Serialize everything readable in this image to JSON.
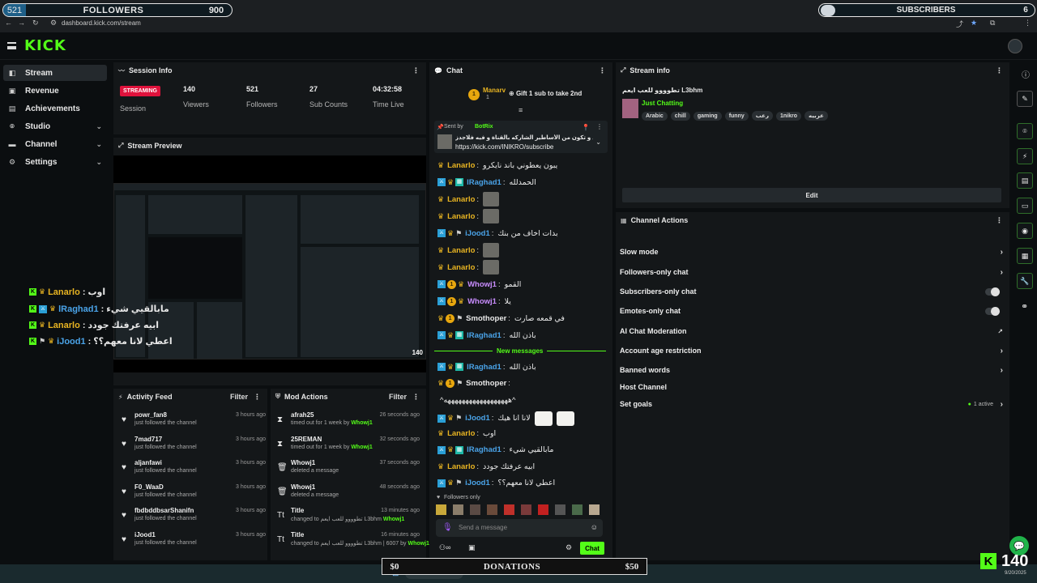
{
  "browser": {
    "url": "dashboard.kick.com/stream"
  },
  "followers_overlay": {
    "current": "521",
    "title": "FOLLOWERS",
    "goal": "900"
  },
  "subs_overlay": {
    "title": "SUBSCRIBERS",
    "goal": "6"
  },
  "brand": {
    "logo": "KICK",
    "accent": "#53fc18"
  },
  "nav": {
    "items": [
      {
        "label": "Stream",
        "icon": "stream-icon",
        "active": true
      },
      {
        "label": "Revenue",
        "icon": "revenue-icon"
      },
      {
        "label": "Achievements",
        "icon": "achievements-icon"
      },
      {
        "label": "Studio",
        "icon": "studio-icon",
        "expandable": true
      },
      {
        "label": "Channel",
        "icon": "channel-icon",
        "expandable": true
      },
      {
        "label": "Settings",
        "icon": "settings-icon",
        "expandable": true
      }
    ]
  },
  "session": {
    "title": "Session Info",
    "badge": "STREAMING",
    "badge_label": "Session",
    "stats": [
      {
        "value": "140",
        "label": "Viewers"
      },
      {
        "value": "521",
        "label": "Followers"
      },
      {
        "value": "27",
        "label": "Sub Counts"
      },
      {
        "value": "04:32:58",
        "label": "Time Live"
      }
    ]
  },
  "preview": {
    "title": "Stream Preview",
    "viewer_count": "140"
  },
  "overlay_chat": [
    {
      "user": "Lanarlo",
      "msg": "اوب"
    },
    {
      "user": "lRaghad1",
      "msg": "مابالقيي شيء"
    },
    {
      "user": "Lanarlo",
      "msg": "ابيه عرفتك جودد"
    },
    {
      "user": "iJood1",
      "msg": "اعطي لانا معهم؟؟"
    }
  ],
  "activity": {
    "title": "Activity Feed",
    "filter": "Filter",
    "items": [
      {
        "user": "powr_fan8",
        "action": "just followed the channel",
        "time": "3 hours ago"
      },
      {
        "user": "7mad717",
        "action": "just followed the channel",
        "time": "3 hours ago"
      },
      {
        "user": "aljanfawi",
        "action": "just followed the channel",
        "time": "3 hours ago"
      },
      {
        "user": "F0_WaaD",
        "action": "just followed the channel",
        "time": "3 hours ago"
      },
      {
        "user": "fbdbddbsarShanifn",
        "action": "just followed the channel",
        "time": "3 hours ago"
      },
      {
        "user": "iJood1",
        "action": "just followed the channel",
        "time": "3 hours ago"
      }
    ]
  },
  "mod": {
    "title": "Mod Actions",
    "filter": "Filter",
    "items": [
      {
        "user": "afrah25",
        "detail": "timed out for 1 week by",
        "by": "Whowj1",
        "time": "26 seconds ago",
        "icon": "hourglass-icon"
      },
      {
        "user": "25REMAN",
        "detail": "timed out for 1 week by",
        "by": "Whowj1",
        "time": "32 seconds ago",
        "icon": "hourglass-icon"
      },
      {
        "user": "Whowj1",
        "detail": "deleted a message",
        "by": "",
        "time": "37 seconds ago",
        "icon": "trash-icon"
      },
      {
        "user": "Whowj1",
        "detail": "deleted a message",
        "by": "",
        "time": "48 seconds ago",
        "icon": "trash-icon"
      },
      {
        "user": "Title",
        "detail": "changed to تطوووو للعب ايعم L3bhm",
        "by": "Whowj1",
        "time": "13 minutes ago",
        "icon": "title-icon"
      },
      {
        "user": "Title",
        "detail": "changed to تطوووو للعب ايعم L3bhm | 6007 by",
        "by": "Whowj1",
        "time": "16 minutes ago",
        "icon": "title-icon"
      }
    ]
  },
  "chat": {
    "title": "Chat",
    "gift_user": "Manarv",
    "gift_count": "1",
    "gift_text": "Gift 1 sub to take 2nd",
    "pinned_by_label": "Sent by",
    "pinned_by": "BotRix",
    "pinned_text": "انا كبي كمصلي و تكون من الأساطير الشاركه بالقناة و فيه فلاجدز",
    "pinned_link": "https://kick.com/INIKRO/subscribe",
    "new_messages": "New messages",
    "followers_only": "Followers only",
    "placeholder": "Send a message",
    "send": "Chat",
    "messages_before": [
      {
        "user": "Lanarlo",
        "cls": "u-lanarlo",
        "msg": "يبون يعطوني باند نايكرو",
        "badges": [
          "crown"
        ]
      },
      {
        "user": "lRaghad1",
        "cls": "u-iraghad",
        "msg": "الحمدلله",
        "badges": [
          "mod",
          "crown",
          "sub-b"
        ]
      },
      {
        "user": "Lanarlo",
        "cls": "u-lanarlo",
        "msg": "",
        "badges": [
          "crown"
        ],
        "emote": true
      },
      {
        "user": "Lanarlo",
        "cls": "u-lanarlo",
        "msg": "",
        "badges": [
          "crown"
        ],
        "emote": true
      },
      {
        "user": "iJood1",
        "cls": "u-ijood",
        "msg": "بدات اخاف من بنك",
        "badges": [
          "mod",
          "crown",
          "gift"
        ]
      },
      {
        "user": "Lanarlo",
        "cls": "u-lanarlo",
        "msg": "",
        "badges": [
          "crown"
        ],
        "emote": true
      },
      {
        "user": "Lanarlo",
        "cls": "u-lanarlo",
        "msg": "",
        "badges": [
          "crown"
        ],
        "emote": true
      },
      {
        "user": "Whowj1",
        "cls": "u-whowj",
        "msg": "القمو",
        "badges": [
          "mod",
          "sub",
          "crown"
        ]
      },
      {
        "user": "Whowj1",
        "cls": "u-whowj",
        "msg": "يلا",
        "badges": [
          "mod",
          "sub",
          "crown"
        ]
      },
      {
        "user": "Smothoper",
        "cls": "u-smoth",
        "msg": "في قمعه صارت",
        "badges": [
          "crown",
          "sub",
          "gift"
        ]
      },
      {
        "user": "lRaghad1",
        "cls": "u-iraghad",
        "msg": "باذن الله",
        "badges": [
          "mod",
          "crown",
          "sub-b"
        ]
      }
    ],
    "messages_after": [
      {
        "user": "lRaghad1",
        "cls": "u-iraghad",
        "msg": "باذن الله",
        "badges": [
          "mod",
          "crown",
          "sub-b"
        ]
      },
      {
        "user": "Smothoper",
        "cls": "u-smoth",
        "msg": "",
        "badges": [
          "crown",
          "sub",
          "gift"
        ]
      },
      {
        "user": "",
        "cls": "u-smoth",
        "msg": "^ههههههههههههههههههه^",
        "badges": []
      },
      {
        "user": "iJood1",
        "cls": "u-ijood",
        "msg": "لانا انا هيك",
        "badges": [
          "mod",
          "crown",
          "gift"
        ],
        "faces": true
      },
      {
        "user": "Lanarlo",
        "cls": "u-lanarlo",
        "msg": "اوب",
        "badges": [
          "crown"
        ]
      },
      {
        "user": "lRaghad1",
        "cls": "u-iraghad",
        "msg": "مابالقيي شيء",
        "badges": [
          "mod",
          "crown",
          "sub-b"
        ]
      },
      {
        "user": "Lanarlo",
        "cls": "u-lanarlo",
        "msg": "ابيه عرفتك جودد",
        "badges": [
          "crown"
        ]
      },
      {
        "user": "iJood1",
        "cls": "u-ijood",
        "msg": "اعطي لانا معهم؟؟",
        "badges": [
          "mod",
          "crown",
          "gift"
        ]
      }
    ]
  },
  "stream_info": {
    "title": "Stream info",
    "stream_title": "تطوووو للعب ايعم L3bhm",
    "category": "Just Chatting",
    "tags": [
      "Arabic",
      "chill",
      "gaming",
      "funny",
      "رعب",
      "1nikro",
      "عربيه"
    ],
    "edit": "Edit"
  },
  "channel_actions": {
    "title": "Channel Actions",
    "items": [
      {
        "label": "Slow mode",
        "type": "chevron"
      },
      {
        "label": "Followers-only chat",
        "type": "chevron"
      },
      {
        "label": "Subscribers-only chat",
        "type": "toggle"
      },
      {
        "label": "Emotes-only chat",
        "type": "toggle"
      },
      {
        "label": "AI Chat Moderation",
        "type": "external"
      },
      {
        "label": "Account age restriction",
        "type": "chevron"
      },
      {
        "label": "Banned words",
        "type": "chevron"
      },
      {
        "label": "Host Channel",
        "type": "none"
      },
      {
        "label": "Set goals",
        "type": "chevron",
        "status": "1 active"
      }
    ]
  },
  "donations": {
    "min": "$0",
    "title": "DONATIONS",
    "max": "$50"
  },
  "viewer_counter": {
    "value": "140"
  },
  "taskbar": {
    "search": "Search",
    "date": "9/20/2025"
  }
}
